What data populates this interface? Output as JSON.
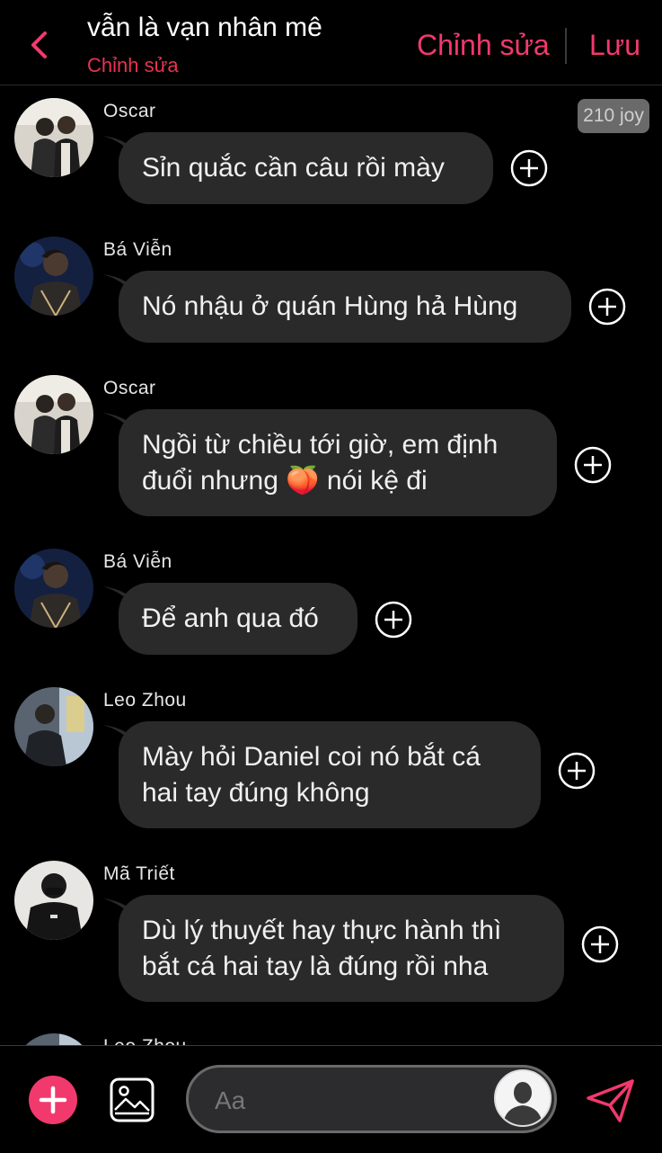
{
  "header": {
    "title": "vẫn là vạn nhân mê",
    "subtitle": "Chỉnh sửa",
    "edit_label": "Chỉnh sửa",
    "save_label": "Lưu"
  },
  "badge": {
    "text": "210 joy"
  },
  "messages": [
    {
      "sender": "Oscar",
      "text": "Sỉn quắc cần câu rồi mày"
    },
    {
      "sender": "Bá Viễn",
      "text": "Nó nhậu ở quán Hùng hả Hùng"
    },
    {
      "sender": "Oscar",
      "text": "Ngồi từ chiều tới giờ, em định\nđuổi nhưng 🍑 nói kệ đi"
    },
    {
      "sender": "Bá Viễn",
      "text": "Để anh qua đó"
    },
    {
      "sender": "Leo Zhou",
      "text": "Mày hỏi Daniel coi nó bắt cá\nhai tay đúng không"
    },
    {
      "sender": "Mã Triết",
      "text": "Dù lý thuyết hay thực hành thì\nbắt cá hai tay là đúng rồi nha"
    },
    {
      "sender": "Leo Zhou",
      "text": ""
    }
  ],
  "composer": {
    "placeholder": "Aa"
  },
  "colors": {
    "accent": "#f2396d",
    "bubble": "#2a2a2b",
    "background": "#000000"
  }
}
